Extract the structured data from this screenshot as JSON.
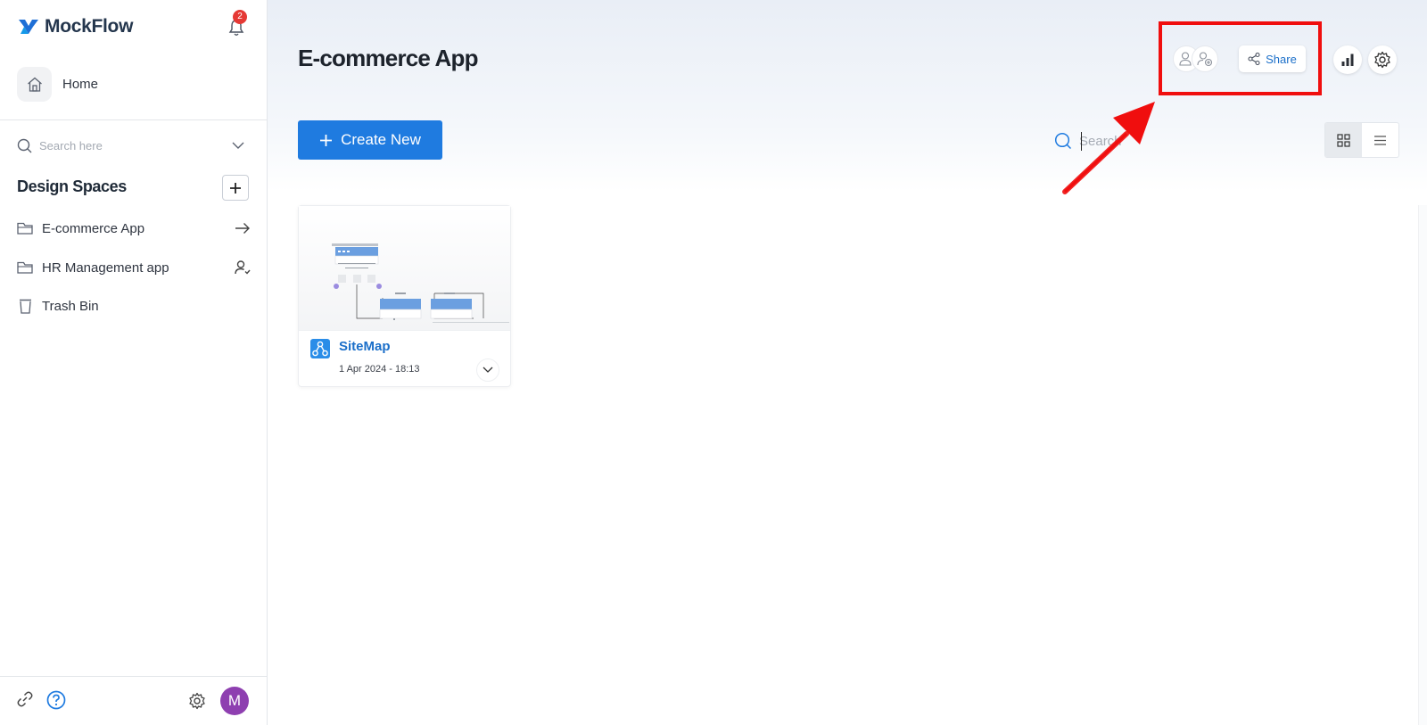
{
  "app": {
    "brand": "MockFlow",
    "notification_count": "2"
  },
  "sidebar": {
    "home_label": "Home",
    "search_placeholder": "Search here",
    "design_spaces_title": "Design Spaces",
    "items": [
      {
        "label": "E-commerce App",
        "icon": "folder-icon",
        "trail_icon": "arrow-right-icon"
      },
      {
        "label": "HR Management app",
        "icon": "folder-icon",
        "trail_icon": "user-shared-icon"
      },
      {
        "label": "Trash Bin",
        "icon": "trash-icon"
      }
    ],
    "avatar_initial": "M"
  },
  "main": {
    "title": "E-commerce App",
    "share_label": "Share",
    "create_label": "Create New",
    "search_placeholder": "Search",
    "view_mode": "grid",
    "cards": [
      {
        "name": "SiteMap",
        "date": "1 Apr 2024 - 18:13",
        "icon": "sitemap-icon"
      }
    ]
  },
  "colors": {
    "accent": "#1f7be0",
    "link": "#1b6fc9",
    "badge": "#e53935",
    "avatar": "#8e3fb0",
    "highlight": "#f00e0e"
  }
}
